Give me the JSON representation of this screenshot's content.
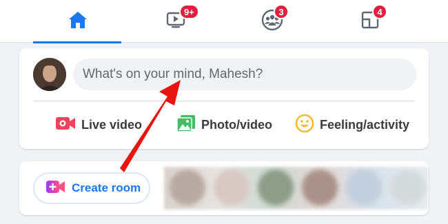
{
  "nav": {
    "tabs": [
      {
        "icon": "home-icon",
        "active": true,
        "badge": ""
      },
      {
        "icon": "watch-icon",
        "active": false,
        "badge": "9+"
      },
      {
        "icon": "groups-icon",
        "active": false,
        "badge": "3"
      },
      {
        "icon": "gaming-icon",
        "active": false,
        "badge": "4"
      }
    ]
  },
  "composer": {
    "placeholder": "What's on your mind, Mahesh?",
    "actions": [
      {
        "label": "Live video",
        "icon": "live-video-icon",
        "color": "#f3425f"
      },
      {
        "label": "Photo/video",
        "icon": "photo-video-icon",
        "color": "#45bd62"
      },
      {
        "label": "Feeling/activity",
        "icon": "feeling-icon",
        "color": "#f7b928"
      }
    ]
  },
  "rooms": {
    "create_label": "Create room"
  },
  "colors": {
    "brand": "#1877f2",
    "badge": "#e41e3f",
    "annotation_arrow": "#e8140f"
  }
}
